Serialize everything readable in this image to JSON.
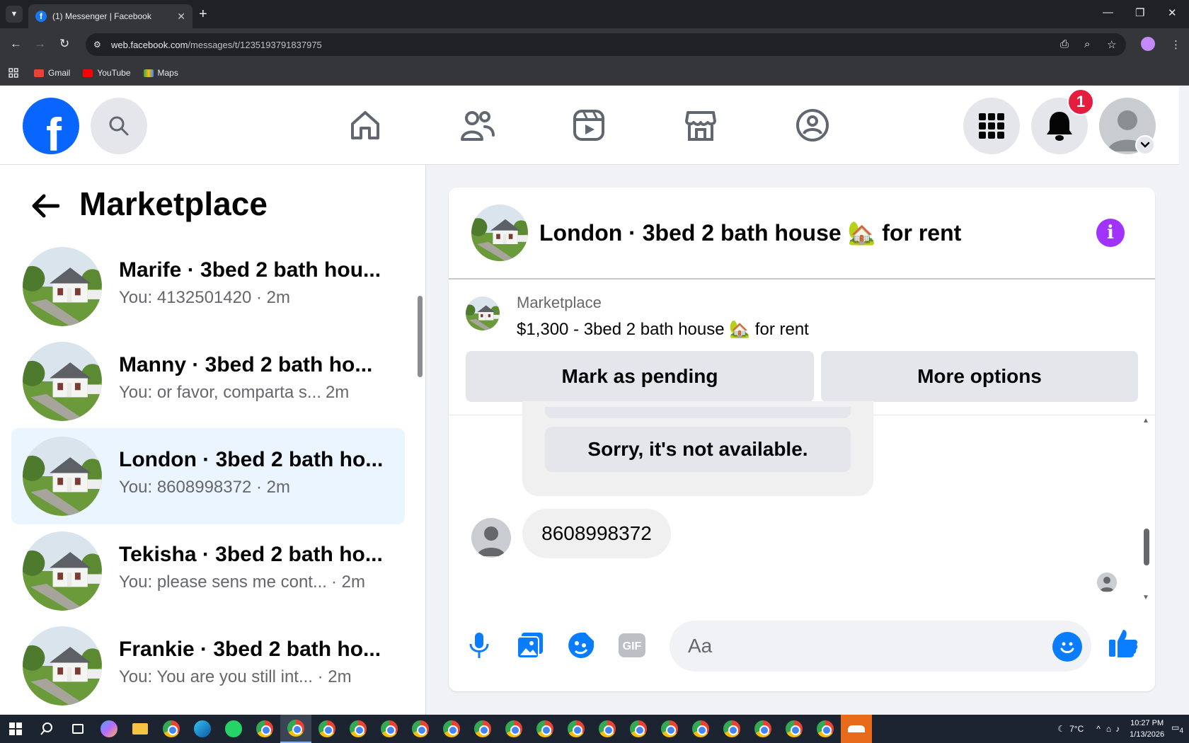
{
  "browser": {
    "tab_title": "(1) Messenger | Facebook",
    "url_domain": "web.facebook.com",
    "url_path": "/messages/t/1235193791837975",
    "bookmarks": [
      "Gmail",
      "YouTube",
      "Maps"
    ]
  },
  "fbnav": {
    "notification_count": "1",
    "icons": [
      "home-icon",
      "friends-icon",
      "video-icon",
      "marketplace-icon",
      "groups-icon"
    ]
  },
  "left_panel": {
    "title": "Marketplace",
    "conversations": [
      {
        "name": "Marife · 3bed 2 bath hou...",
        "snippet": "You: 4132501420 · 2m",
        "time": ""
      },
      {
        "name": "Manny · 3bed 2 bath ho...",
        "snippet": "You: or favor, comparta s...",
        "time": "2m"
      },
      {
        "name": "London · 3bed 2 bath ho...",
        "snippet": "You: 8608998372 · 2m",
        "time": "",
        "active": true
      },
      {
        "name": "Tekisha · 3bed 2 bath ho...",
        "snippet": "You: please sens me cont...",
        "time": "· 2m"
      },
      {
        "name": "Frankie · 3bed 2 bath ho...",
        "snippet": "You: You are you still int... · 2m",
        "time": ""
      }
    ]
  },
  "chat": {
    "title": "London · 3bed 2 bath house 🏡 for rent",
    "listing_source": "Marketplace",
    "listing_desc": "$1,300 - 3bed 2 bath house 🏡 for rent",
    "mark_pending": "Mark as pending",
    "more_options": "More options",
    "reply_option": "Sorry, it's not available.",
    "message": "8608998372",
    "input_placeholder": "Aa"
  },
  "taskbar": {
    "weather": "7°C",
    "time": "10:27 PM",
    "date": "1/13/2026",
    "notif_count": "4"
  }
}
